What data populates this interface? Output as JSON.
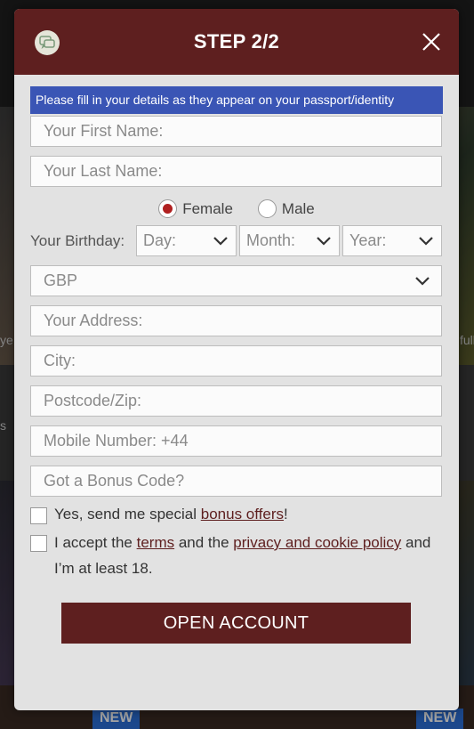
{
  "header": {
    "title": "STEP 2/2"
  },
  "notice": "Please fill in your details as they appear on your passport/identity",
  "fields": {
    "first_name": "Your First Name:",
    "last_name": "Your Last Name:",
    "address": "Your Address:",
    "city": "City:",
    "postcode": "Postcode/Zip:",
    "mobile": "Mobile Number: +44",
    "bonus_code": "Got a Bonus Code?"
  },
  "gender": {
    "female": "Female",
    "male": "Male",
    "selected": "Female"
  },
  "birthday": {
    "label": "Your Birthday:",
    "day": "Day:",
    "month": "Month:",
    "year": "Year:"
  },
  "currency": "GBP",
  "checks": {
    "bonus_prefix": "Yes, send me special ",
    "bonus_link": "bonus offers",
    "bonus_suffix": "!",
    "terms_prefix": "I accept the ",
    "terms_link": "terms",
    "terms_mid": " and the ",
    "privacy_link": "privacy and cookie policy",
    "terms_suffix": " and I’m at least 18."
  },
  "submit_label": "OPEN ACCOUNT",
  "background": {
    "badge": "NEW",
    "snippet_left": "s",
    "snippet_left2": "ye",
    "snippet_right": "full"
  },
  "colors": {
    "header": "#5e1f1f",
    "notice": "#3a55b5",
    "radio_selected": "#b02020",
    "button": "#5e1f1f"
  }
}
